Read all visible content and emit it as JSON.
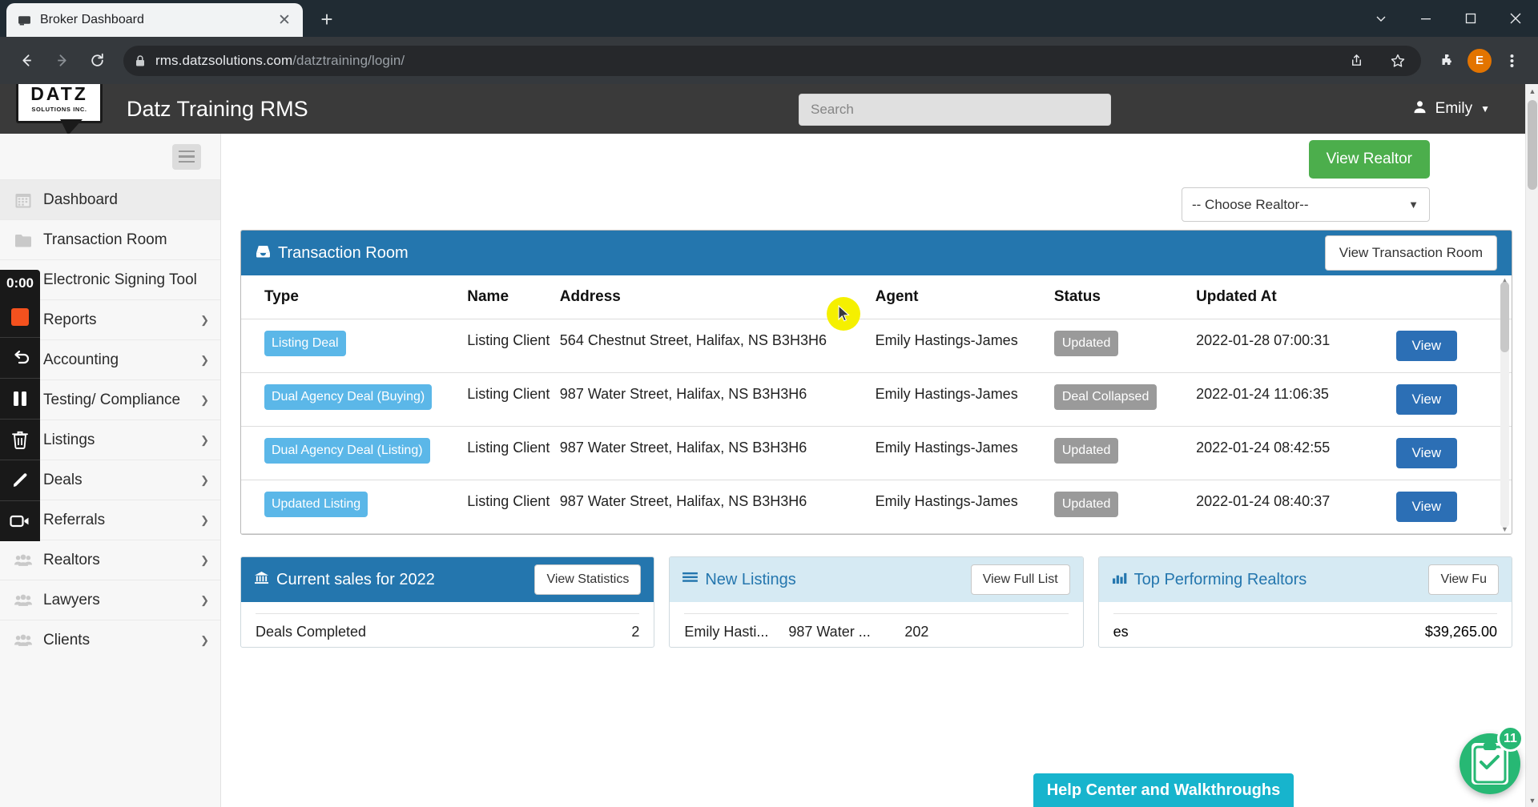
{
  "browser": {
    "tab_title": "Broker Dashboard",
    "tab_favicon_icon": "window-icon",
    "close_icon": "close-icon",
    "new_tab_icon": "plus-icon",
    "minimize_icon": "minimize-icon",
    "restore_icon": "restore-icon",
    "window_close_icon": "close-icon",
    "collapse_icon": "chevron-down-icon",
    "back_icon": "arrow-left-icon",
    "forward_icon": "arrow-right-icon",
    "reload_icon": "reload-icon",
    "lock_icon": "lock-icon",
    "url_domain": "rms.datzsolutions.com",
    "url_path": "/datztraining/login/",
    "share_icon": "share-icon",
    "bookmark_icon": "star-icon",
    "extensions_icon": "puzzle-icon",
    "profile_initial": "E",
    "menu_icon": "kebab-menu-icon"
  },
  "app": {
    "logo_main": "DATZ",
    "logo_sub": "SOLUTIONS INC.",
    "title": "Datz Training RMS",
    "search_placeholder": "Search",
    "search_value": "",
    "user_name": "Emily",
    "user_icon": "user-icon",
    "caret_icon": "chevron-down-icon"
  },
  "sidebar": {
    "toggle_icon": "hamburger-icon",
    "items": [
      {
        "label": "Dashboard",
        "icon": "calendar-icon",
        "chevron": "",
        "active": true
      },
      {
        "label": "Transaction Room",
        "icon": "folder-icon",
        "chevron": "",
        "active": false
      },
      {
        "label": "Electronic Signing Tool",
        "icon": "pen-icon",
        "chevron": "",
        "active": false
      },
      {
        "label": "Reports",
        "icon": "chart-icon",
        "chevron": "❯",
        "active": false
      },
      {
        "label": "Accounting",
        "icon": "calculator-icon",
        "chevron": "❯",
        "active": false
      },
      {
        "label": "Testing/ Compliance",
        "icon": "clipboard-icon",
        "chevron": "❯",
        "active": false
      },
      {
        "label": "Listings",
        "icon": "home-icon",
        "chevron": "❯",
        "active": false
      },
      {
        "label": "Deals",
        "icon": "handshake-icon",
        "chevron": "❯",
        "active": false
      },
      {
        "label": "Referrals",
        "icon": "document-icon",
        "chevron": "❯",
        "active": false
      },
      {
        "label": "Realtors",
        "icon": "people-icon",
        "chevron": "❯",
        "active": false
      },
      {
        "label": "Lawyers",
        "icon": "people-icon",
        "chevron": "❯",
        "active": false
      },
      {
        "label": "Clients",
        "icon": "people-icon",
        "chevron": "❯",
        "active": false
      }
    ]
  },
  "realtor": {
    "view_button": "View Realtor",
    "select_value": "-- Choose Realtor--"
  },
  "transaction_room": {
    "panel_title": "Transaction Room",
    "panel_icon": "inbox-icon",
    "view_button": "View Transaction Room",
    "columns": [
      "Type",
      "Name",
      "Address",
      "Agent",
      "Status",
      "Updated At",
      ""
    ],
    "rows": [
      {
        "type": "Listing Deal",
        "name": "Listing Client",
        "address": "564 Chestnut Street, Halifax, NS B3H3H6",
        "agent": "Emily Hastings-James",
        "status": "Updated",
        "updated_at": "2022-01-28 07:00:31",
        "action": "View"
      },
      {
        "type": "Dual Agency Deal (Buying)",
        "name": "Listing Client",
        "address": "987 Water Street, Halifax, NS B3H3H6",
        "agent": "Emily Hastings-James",
        "status": "Deal Collapsed",
        "updated_at": "2022-01-24 11:06:35",
        "action": "View"
      },
      {
        "type": "Dual Agency Deal (Listing)",
        "name": "Listing Client",
        "address": "987 Water Street, Halifax, NS B3H3H6",
        "agent": "Emily Hastings-James",
        "status": "Updated",
        "updated_at": "2022-01-24 08:42:55",
        "action": "View"
      },
      {
        "type": "Updated Listing",
        "name": "Listing Client",
        "address": "987 Water Street, Halifax, NS B3H3H6",
        "agent": "Emily Hastings-James",
        "status": "Updated",
        "updated_at": "2022-01-24 08:40:37",
        "action": "View"
      }
    ]
  },
  "cards": {
    "sales": {
      "title": "Current sales for 2022",
      "icon": "bank-icon",
      "button": "View Statistics",
      "rows": [
        {
          "label": "Deals Completed",
          "value": "2"
        }
      ]
    },
    "new_listings": {
      "title": "New Listings",
      "icon": "list-icon",
      "button": "View Full List",
      "rows": [
        {
          "c1": "Emily Hasti...",
          "c2": "987 Water ...",
          "c3": "202"
        }
      ]
    },
    "top_realtors": {
      "title": "Top Performing Realtors",
      "icon": "bar-chart-icon",
      "button": "View Fu",
      "rows": [
        {
          "label": "es",
          "value": "$39,265.00"
        }
      ]
    }
  },
  "help": {
    "bar_label": "Help Center and Walkthroughs",
    "fab_icon": "clipboard-check-icon",
    "badge_count": "11"
  },
  "recorder": {
    "time": "0:00",
    "stop_icon": "stop-square-icon",
    "undo_icon": "undo-icon",
    "pause_icon": "pause-icon",
    "delete_icon": "trash-icon",
    "draw_icon": "pencil-icon",
    "camera_icon": "video-camera-icon"
  },
  "scrollbar": {
    "up_icon": "chevron-up-icon",
    "down_icon": "chevron-down-icon"
  },
  "colors": {
    "accent_blue": "#2476ae",
    "green": "#4cae4c",
    "badge_blue": "#5bb7e8",
    "status_gray": "#9a9a9a",
    "teal": "#17b4cd"
  }
}
